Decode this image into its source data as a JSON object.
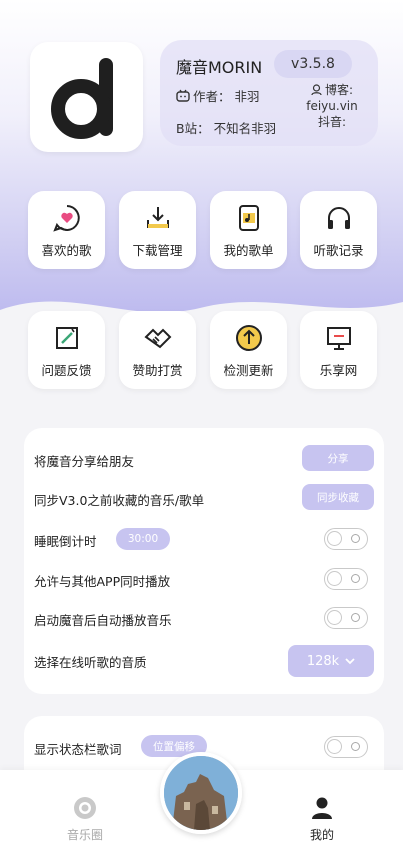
{
  "app": {
    "name": "魔音MORIN",
    "version": "v3.5.8",
    "author_label": "作者：",
    "author_name": "非羽",
    "bilibili_label": "B站：",
    "bilibili_name": "不知名非羽",
    "blog_label": "博客:",
    "blog_value": "feiyu.vin",
    "douyin_label": "抖音:"
  },
  "menu": [
    {
      "label": "喜欢的歌",
      "icon": "heart-chat-icon"
    },
    {
      "label": "下载管理",
      "icon": "download-icon"
    },
    {
      "label": "我的歌单",
      "icon": "playlist-icon"
    },
    {
      "label": "听歌记录",
      "icon": "headphones-icon"
    },
    {
      "label": "问题反馈",
      "icon": "feedback-icon"
    },
    {
      "label": "赞助打赏",
      "icon": "handshake-icon"
    },
    {
      "label": "检测更新",
      "icon": "update-icon"
    },
    {
      "label": "乐享网",
      "icon": "monitor-icon"
    }
  ],
  "settings": {
    "share_label": "将魔音分享给朋友",
    "share_button": "分享",
    "sync_label": "同步V3.0之前收藏的音乐/歌单",
    "sync_button": "同步收藏",
    "sleep_label": "睡眠倒计时",
    "sleep_value": "30:00",
    "mix_label": "允许与其他APP同时播放",
    "autoplay_label": "启动魔音后自动播放音乐",
    "quality_label": "选择在线听歌的音质",
    "quality_value": "128k",
    "lyrics_label": "显示状态栏歌词",
    "lyrics_button": "位置偏移"
  },
  "nav": {
    "left_label": "音乐圈",
    "right_label": "我的"
  },
  "colors": {
    "accent": "#c7c4f0",
    "header_gradient": "#b9b6ee"
  }
}
